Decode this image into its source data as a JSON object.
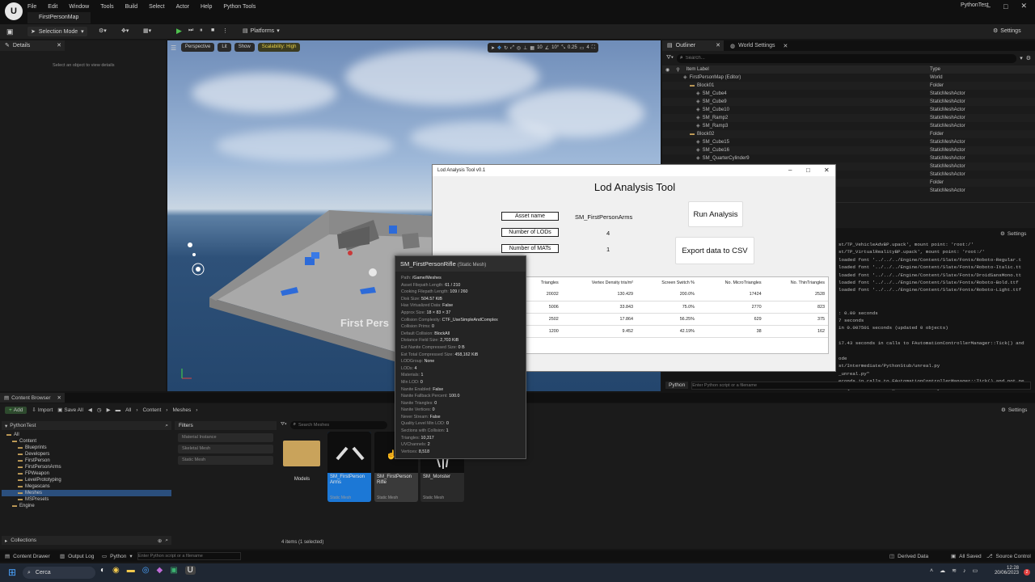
{
  "app": {
    "menu": [
      "File",
      "Edit",
      "Window",
      "Tools",
      "Build",
      "Select",
      "Actor",
      "Help",
      "Python Tools"
    ],
    "map_tab": "FirstPersonMap",
    "project_name": "PythonTest"
  },
  "toolbar": {
    "selection_mode": "Selection Mode",
    "platforms": "Platforms",
    "settings": "Settings"
  },
  "details": {
    "tab": "Details",
    "empty_text": "Select an object to view details"
  },
  "viewport": {
    "perspective": "Perspective",
    "lit": "Lit",
    "show": "Show",
    "scalability": "Scalability: High",
    "grid_size": "10",
    "rot_snap": "10°",
    "scale_snap": "0.25",
    "cam_speed": "4",
    "floor_text": "First Pers"
  },
  "outliner": {
    "tab": "Outliner",
    "world_settings_tab": "World Settings",
    "search_placeholder": "Search...",
    "col_label": "Item Label",
    "col_type": "Type",
    "rows": [
      {
        "label": "FirstPersonMap (Editor)",
        "type": "World",
        "indent": 0
      },
      {
        "label": "Block01",
        "type": "Folder",
        "indent": 1
      },
      {
        "label": "SM_Cube4",
        "type": "StaticMeshActor",
        "indent": 2
      },
      {
        "label": "SM_Cube9",
        "type": "StaticMeshActor",
        "indent": 2
      },
      {
        "label": "SM_Cube10",
        "type": "StaticMeshActor",
        "indent": 2
      },
      {
        "label": "SM_Ramp2",
        "type": "StaticMeshActor",
        "indent": 2
      },
      {
        "label": "SM_Ramp3",
        "type": "StaticMeshActor",
        "indent": 2
      },
      {
        "label": "Block02",
        "type": "Folder",
        "indent": 1
      },
      {
        "label": "SM_Cube15",
        "type": "StaticMeshActor",
        "indent": 2
      },
      {
        "label": "SM_Cube16",
        "type": "StaticMeshActor",
        "indent": 2
      },
      {
        "label": "SM_QuarterCylinder9",
        "type": "StaticMeshActor",
        "indent": 2
      },
      {
        "label": "",
        "type": "StaticMeshActor",
        "indent": 2
      },
      {
        "label": "",
        "type": "StaticMeshActor",
        "indent": 2
      },
      {
        "label": "",
        "type": "Folder",
        "indent": 1
      },
      {
        "label": "",
        "type": "StaticMeshActor",
        "indent": 2
      }
    ]
  },
  "output_log": {
    "settings": "Settings",
    "lines": [
      "st/TP_VehicleAdvBP.upack', mount point: 'root:/'",
      "st/TP_VirtualRealityBP.upack', mount point: 'root:/'",
      "loaded font '../../../Engine/Content/Slate/Fonts/Roboto-Regular.t",
      "loaded font '../../../Engine/Content/Slate/Fonts/Roboto-Italic.tt",
      "loaded font '../../../Engine/Content/Slate/Fonts/DroidSansMono.tt",
      "loaded font '../../../Engine/Content/Slate/Fonts/Roboto-Bold.ttf",
      "loaded font '../../../Engine/Content/Slate/Fonts/Roboto-Light.ttf",
      "",
      "",
      ": 0.00 seconds",
      "7 seconds",
      "in 0.007501 seconds (updated 0 objects)",
      "",
      "17.43 seconds in calls to FAutomationControllerManager::Tick() and",
      "",
      "ode",
      "st/Intermediate/PythonStub/unreal.py",
      "_unreal.py\"",
      "econds in calls to FAutomationControllerManager::Tick() and not pe",
      "6/ {/Game/Meshes/SM_FirstPersonArms} ..."
    ],
    "cmd_mode": "Python",
    "cmd_placeholder": "Enter Python script or a filename"
  },
  "lod_tool": {
    "window_title": "Lod Analysis Tool v0.1",
    "heading": "Lod Analysis Tool",
    "asset_label": "Asset name",
    "asset_value": "SM_FirstPersonArms",
    "lods_label": "Number of LODs",
    "lods_value": "4",
    "mats_label": "Number of MATs",
    "mats_value": "1",
    "run_button": "Run Analysis",
    "export_button": "Export data to CSV",
    "columns": [
      "dex",
      "Triangles",
      "Vertex Density tris/m²",
      "Screen Switch %",
      "No. MicroTriangles",
      "No. ThinTriangles"
    ],
    "rows": [
      [
        "0",
        "20032",
        "130.429",
        "200.0%",
        "17424",
        "2528"
      ],
      [
        "1",
        "5006",
        "33.843",
        "75.0%",
        "2770",
        "823"
      ],
      [
        "2",
        "2502",
        "17.864",
        "56.25%",
        "629",
        "375"
      ],
      [
        "3",
        "1200",
        "9.452",
        "42.19%",
        "38",
        "162"
      ]
    ]
  },
  "tooltip": {
    "title": "SM_FirstPersonRifle",
    "subtitle": "(Static Mesh)",
    "rows": [
      [
        "Path:",
        "/Game/Meshes"
      ],
      [
        "Asset Filepath Length:",
        "61 / 210"
      ],
      [
        "Cooking Filepath Length:",
        "109 / 260"
      ],
      [
        "Disk Size:",
        "504.57 KiB"
      ],
      [
        "Has Virtualized Data:",
        "False"
      ],
      [
        "Approx Size:",
        "18 × 83 × 37"
      ],
      [
        "Collision Complexity:",
        "CTF_UseSimpleAndComplex"
      ],
      [
        "Collision Prims:",
        "0"
      ],
      [
        "Default Collision:",
        "BlockAll"
      ],
      [
        "Distance Field Size:",
        "2,703 KiB"
      ],
      [
        "Est Nanite Compressed Size:",
        "0 B"
      ],
      [
        "Est Total Compressed Size:",
        "458,162 KiB"
      ],
      [
        "LODGroup:",
        "None"
      ],
      [
        "LODs:",
        "4"
      ],
      [
        "Materials:",
        "1"
      ],
      [
        "Min LOD:",
        "0"
      ],
      [
        "Nanite Enabled:",
        "False"
      ],
      [
        "Nanite Fallback Percent:",
        "100.0"
      ],
      [
        "Nanite Triangles:",
        "0"
      ],
      [
        "Nanite Vertices:",
        "0"
      ],
      [
        "Never Stream:",
        "False"
      ],
      [
        "Quality Level Min LOD:",
        "0"
      ],
      [
        "Sections with Collision:",
        "1"
      ],
      [
        "Triangles:",
        "10,317"
      ],
      [
        "UVChannels:",
        "2"
      ],
      [
        "Vertices:",
        "8,518"
      ]
    ]
  },
  "content_browser": {
    "tab": "Content Browser",
    "add": "Add",
    "import": "Import",
    "save_all": "Save All",
    "breadcrumb": [
      "All",
      "Content",
      "Meshes"
    ],
    "settings": "Settings",
    "project": "PythonTest",
    "tree": [
      {
        "label": "All",
        "indent": 0
      },
      {
        "label": "Content",
        "indent": 1
      },
      {
        "label": "Blueprints",
        "indent": 2
      },
      {
        "label": "Developers",
        "indent": 2
      },
      {
        "label": "FirstPerson",
        "indent": 2
      },
      {
        "label": "FirstPersonArms",
        "indent": 2
      },
      {
        "label": "FPWeapon",
        "indent": 2
      },
      {
        "label": "LevelPrototyping",
        "indent": 2
      },
      {
        "label": "Megascans",
        "indent": 2
      },
      {
        "label": "Meshes",
        "indent": 2
      },
      {
        "label": "MSPresets",
        "indent": 2
      },
      {
        "label": "Engine",
        "indent": 1
      }
    ],
    "filters_title": "Filters",
    "filters": [
      "Material Instance",
      "Skeletal Mesh",
      "Static Mesh"
    ],
    "search_placeholder": "Search Meshes",
    "folder_name": "Models",
    "assets": [
      {
        "name": "SM_FirstPerson Arms",
        "type": "Static Mesh"
      },
      {
        "name": "SM_FirstPerson Rifle",
        "type": "Static Mesh"
      },
      {
        "name": "SM_Monster",
        "type": "Static Mesh"
      }
    ],
    "collections": "Collections",
    "item_count": "4 items (1 selected)"
  },
  "status_bar": {
    "content_drawer": "Content Drawer",
    "output_log": "Output Log",
    "cmd": "Python",
    "cmd_placeholder": "Enter Python script or a filename",
    "derived_data": "Derived Data",
    "all_saved": "All Saved",
    "source_control": "Source Control"
  },
  "taskbar": {
    "search": "Cerca",
    "time": "12:28",
    "date": "20/06/2023"
  }
}
